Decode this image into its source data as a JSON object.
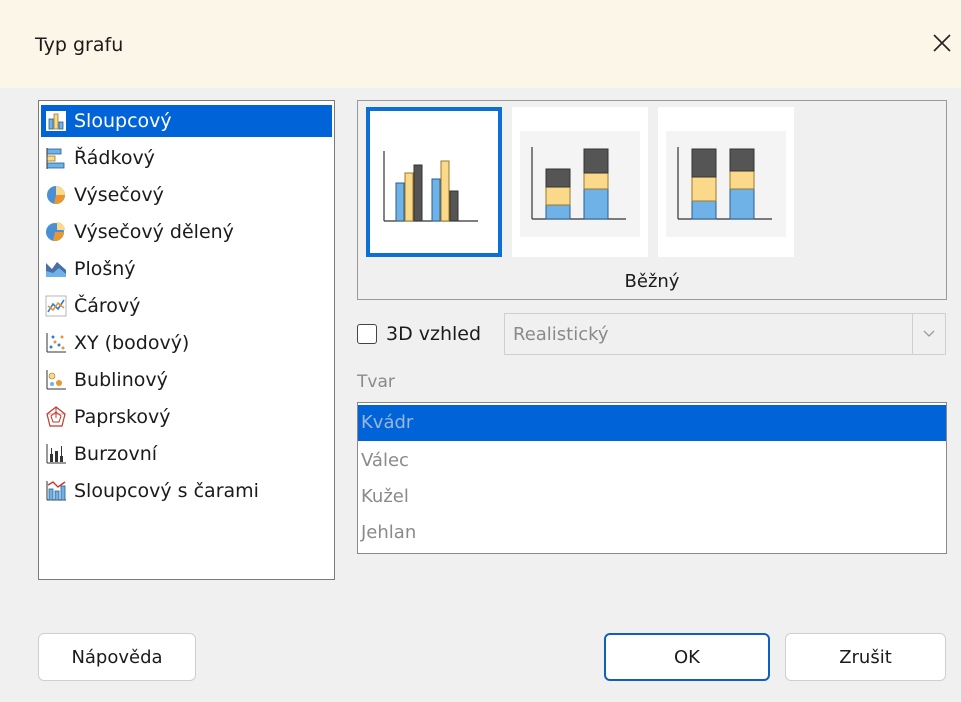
{
  "dialog": {
    "title": "Typ grafu",
    "close_icon": "close-icon"
  },
  "chart_types": [
    {
      "label": "Sloupcový",
      "icon": "column-chart-icon",
      "selected": true
    },
    {
      "label": "Řádkový",
      "icon": "bar-chart-icon",
      "selected": false
    },
    {
      "label": "Výsečový",
      "icon": "pie-chart-icon",
      "selected": false
    },
    {
      "label": "Výsečový dělený",
      "icon": "exploded-pie-chart-icon",
      "selected": false
    },
    {
      "label": "Plošný",
      "icon": "area-chart-icon",
      "selected": false
    },
    {
      "label": "Čárový",
      "icon": "line-chart-icon",
      "selected": false
    },
    {
      "label": "XY (bodový)",
      "icon": "scatter-chart-icon",
      "selected": false
    },
    {
      "label": "Bublinový",
      "icon": "bubble-chart-icon",
      "selected": false
    },
    {
      "label": "Paprskový",
      "icon": "radar-chart-icon",
      "selected": false
    },
    {
      "label": "Burzovní",
      "icon": "stock-chart-icon",
      "selected": false
    },
    {
      "label": "Sloupcový s čarami",
      "icon": "column-line-chart-icon",
      "selected": false
    }
  ],
  "subtypes": {
    "selected_name": "Běžný",
    "items": [
      {
        "icon": "clustered-column-icon",
        "selected": true
      },
      {
        "icon": "stacked-column-icon",
        "selected": false
      },
      {
        "icon": "percent-stacked-column-icon",
        "selected": false
      }
    ]
  },
  "appearance_3d": {
    "checkbox_label": "3D vzhled",
    "checked": false,
    "style_value": "Realistický"
  },
  "shape": {
    "label": "Tvar",
    "items": [
      "Kvádr",
      "Válec",
      "Kužel",
      "Jehlan"
    ],
    "selected_index": 0
  },
  "buttons": {
    "help": "Nápověda",
    "ok": "OK",
    "cancel": "Zrušit"
  },
  "colors": {
    "selection": "#0063d8",
    "bar_blue": "#6fb2e8",
    "bar_yellow": "#fbd98b",
    "bar_dark": "#5a5a5a"
  }
}
